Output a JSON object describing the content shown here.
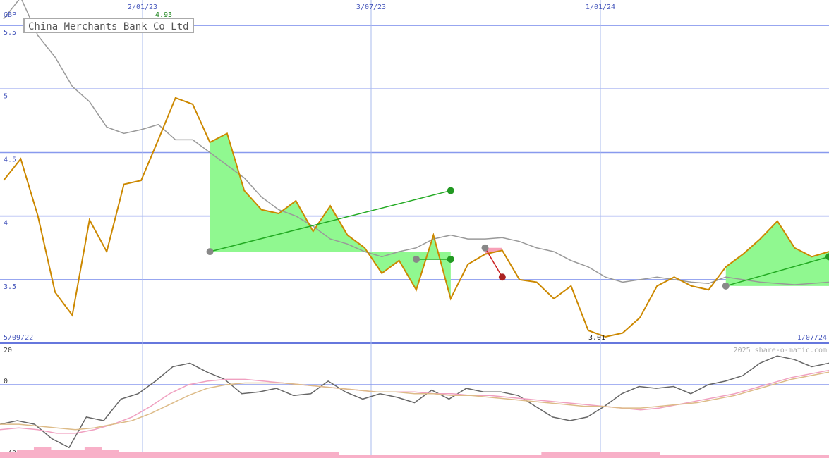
{
  "chart_data": [
    {
      "type": "line",
      "title": "China Merchants Bank Co Ltd",
      "currency": "GBP",
      "ylim": [
        3.0,
        5.7
      ],
      "y_ticks": [
        "5.5",
        "5",
        "4.5",
        "4",
        "3.5"
      ],
      "y_tick_values": [
        5.5,
        5.0,
        4.5,
        4.0,
        3.5
      ],
      "x_date_labels": [
        "2/01/23",
        "3/07/23",
        "1/01/24"
      ],
      "range_start_label": "5/09/22",
      "range_end_label": "1/07/24",
      "max_label": "4.93",
      "min_label": "3.01",
      "copyright": "2025 share-o-matic.com",
      "grid": true,
      "series": [
        {
          "color": "#cc8800",
          "x": [
            "5/09/22",
            "19/09/22",
            "3/10/22",
            "17/10/22",
            "31/10/22",
            "14/11/22",
            "28/11/22",
            "12/12/22",
            "26/12/22",
            "9/01/23",
            "23/01/23",
            "6/02/23",
            "20/02/23",
            "6/03/23",
            "20/03/23",
            "3/04/23",
            "17/04/23",
            "1/05/23",
            "15/05/23",
            "29/05/23",
            "12/06/23",
            "26/06/23",
            "10/07/23",
            "24/07/23",
            "7/08/23",
            "21/08/23",
            "4/09/23",
            "18/09/23",
            "2/10/23",
            "16/10/23",
            "30/10/23",
            "13/11/23",
            "27/11/23",
            "11/12/23",
            "25/12/23",
            "8/01/24",
            "22/01/24",
            "5/02/24",
            "19/02/24",
            "4/03/24",
            "18/03/24",
            "1/04/24",
            "15/04/24",
            "29/04/24",
            "13/05/24",
            "27/05/24",
            "10/06/24",
            "24/06/24",
            "8/07/24"
          ],
          "values": [
            4.28,
            4.45,
            4.0,
            3.4,
            3.22,
            3.97,
            3.72,
            4.25,
            4.28,
            4.6,
            4.93,
            4.88,
            4.58,
            4.65,
            4.2,
            4.05,
            4.02,
            4.12,
            3.88,
            4.08,
            3.85,
            3.75,
            3.55,
            3.65,
            3.42,
            3.85,
            3.35,
            3.62,
            3.7,
            3.73,
            3.5,
            3.48,
            3.35,
            3.45,
            3.1,
            3.05,
            3.08,
            3.2,
            3.45,
            3.52,
            3.45,
            3.42,
            3.6,
            3.7,
            3.82,
            3.96,
            3.75,
            3.68,
            3.72
          ]
        },
        {
          "color": "#999999",
          "x": [
            "5/09/22",
            "19/09/22",
            "3/10/22",
            "17/10/22",
            "31/10/22",
            "14/11/22",
            "28/11/22",
            "12/12/22",
            "26/12/22",
            "9/01/23",
            "23/01/23",
            "6/02/23",
            "20/02/23",
            "6/03/23",
            "20/03/23",
            "3/04/23",
            "17/04/23",
            "1/05/23",
            "15/05/23",
            "29/05/23",
            "12/06/23",
            "26/06/23",
            "10/07/23",
            "24/07/23",
            "7/08/23",
            "21/08/23",
            "4/09/23",
            "18/09/23",
            "2/10/23",
            "16/10/23",
            "30/10/23",
            "13/11/23",
            "27/11/23",
            "11/12/23",
            "25/12/23",
            "8/01/24",
            "22/01/24",
            "5/02/24",
            "19/02/24",
            "4/03/24",
            "18/03/24",
            "1/04/24",
            "15/04/24",
            "29/04/24",
            "13/05/24",
            "27/05/24",
            "10/06/24",
            "24/06/24",
            "8/07/24"
          ],
          "values": [
            5.55,
            5.72,
            5.42,
            5.25,
            5.02,
            4.9,
            4.7,
            4.65,
            4.68,
            4.72,
            4.6,
            4.6,
            4.5,
            4.4,
            4.3,
            4.15,
            4.05,
            4.0,
            3.92,
            3.82,
            3.78,
            3.72,
            3.68,
            3.72,
            3.75,
            3.82,
            3.85,
            3.82,
            3.82,
            3.83,
            3.8,
            3.75,
            3.72,
            3.65,
            3.6,
            3.52,
            3.48,
            3.5,
            3.52,
            3.5,
            3.48,
            3.47,
            3.52,
            3.5,
            3.48,
            3.47,
            3.46,
            3.47,
            3.48
          ]
        }
      ],
      "annotations": {
        "green_regions": [
          {
            "start": "20/02/23",
            "end": "4/09/23",
            "entry_value": 3.72,
            "exit_value": 4.2
          },
          {
            "start": "7/08/23",
            "end": "4/09/23",
            "entry_value": 3.66,
            "exit_value": 3.66
          },
          {
            "start": "15/04/24",
            "end": "8/07/24",
            "entry_value": 3.45,
            "exit_value": 3.68
          }
        ],
        "red_regions": [
          {
            "start": "2/10/23",
            "end": "16/10/23",
            "entry_value": 3.75,
            "exit_value": 3.52
          }
        ]
      }
    },
    {
      "type": "line",
      "title": "",
      "ylim": [
        -40,
        20
      ],
      "y_ticks": [
        "20",
        "0",
        "-40"
      ],
      "y_tick_values": [
        20,
        0,
        -40
      ],
      "series": [
        {
          "color": "#666666",
          "values": [
            -22,
            -20,
            -22,
            -30,
            -35,
            -18,
            -20,
            -8,
            -5,
            2,
            10,
            12,
            7,
            3,
            -5,
            -4,
            -2,
            -6,
            -5,
            2,
            -4,
            -8,
            -5,
            -7,
            -10,
            -3,
            -8,
            -2,
            -4,
            -4,
            -6,
            -12,
            -18,
            -20,
            -18,
            -12,
            -5,
            -1,
            -2,
            -1,
            -5,
            0,
            2,
            5,
            12,
            16,
            14,
            10,
            12
          ]
        },
        {
          "color": "#f0a0c0",
          "values": [
            -25,
            -24,
            -25,
            -27,
            -27,
            -25,
            -22,
            -18,
            -12,
            -5,
            0,
            2,
            3,
            3,
            2,
            1,
            0,
            -1,
            -2,
            -3,
            -4,
            -4,
            -4,
            -5,
            -5,
            -6,
            -6,
            -7,
            -8,
            -9,
            -10,
            -11,
            -12,
            -13,
            -14,
            -13,
            -11,
            -9,
            -7,
            -5,
            -2,
            1,
            4,
            6,
            8
          ]
        },
        {
          "color": "#ddbb88",
          "values": [
            -22,
            -22,
            -23,
            -24,
            -25,
            -24,
            -22,
            -20,
            -16,
            -11,
            -6,
            -2,
            0,
            1,
            1,
            1,
            0,
            -1,
            -2,
            -3,
            -4,
            -4,
            -5,
            -5,
            -6,
            -6,
            -7,
            -8,
            -9,
            -10,
            -11,
            -12,
            -12,
            -13,
            -13,
            -12,
            -11,
            -10,
            -8,
            -6,
            -3,
            0,
            3,
            5,
            7
          ]
        }
      ],
      "volume_bars": [
        2,
        3,
        4,
        3,
        3,
        4,
        3,
        2,
        2,
        2,
        2,
        2,
        2,
        2,
        2,
        2,
        2,
        2,
        2,
        2,
        1,
        1,
        1,
        1,
        1,
        1,
        1,
        1,
        1,
        1,
        1,
        1,
        2,
        2,
        2,
        2,
        2,
        2,
        2,
        1,
        1,
        1,
        1,
        1,
        1,
        1,
        1,
        1,
        1
      ]
    }
  ]
}
